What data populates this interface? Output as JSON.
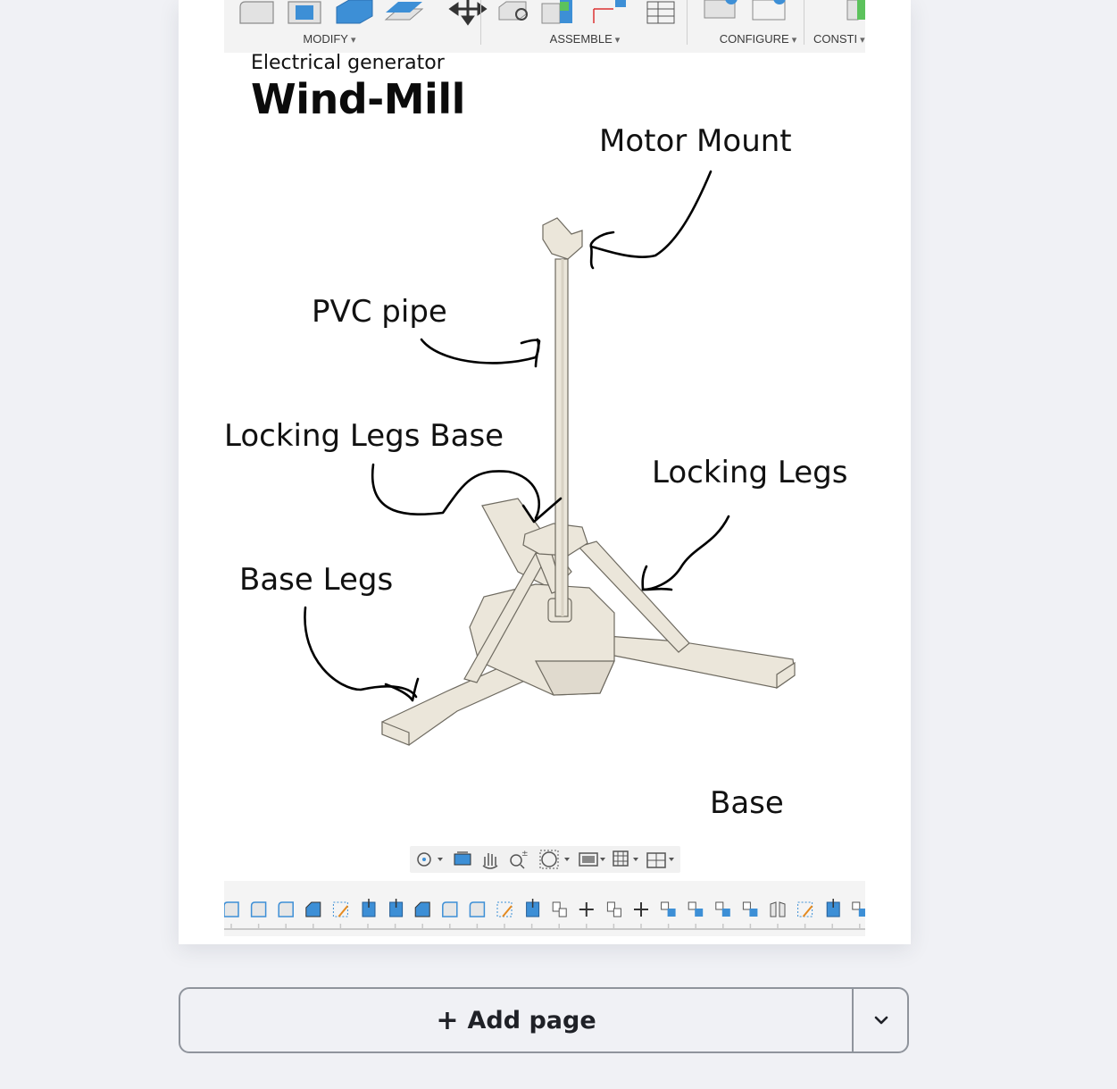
{
  "ribbon": {
    "groups": [
      {
        "label": "MODIFY"
      },
      {
        "label": "ASSEMBLE"
      },
      {
        "label": "CONFIGURE"
      },
      {
        "label": "CONSTI"
      }
    ]
  },
  "slide": {
    "subtitle": "Electrical generator",
    "title": "Wind-Mill",
    "labels": {
      "motor_mount": "Motor Mount",
      "pvc_pipe": "PVC pipe",
      "locking_legs_base": "Locking Legs Base",
      "locking_legs": "Locking Legs",
      "base_legs": "Base Legs",
      "base": "Base"
    }
  },
  "viewport_nav": {
    "icons": [
      "orbit-icon",
      "look-at-icon",
      "pan-hand-icon",
      "zoom-icon",
      "fit-window-icon",
      "display-settings-icon",
      "grid-icon",
      "viewports-icon"
    ]
  },
  "actions": {
    "add_page": "Add page",
    "add_page_icon": "plus-icon",
    "menu_icon": "chevron-down-icon"
  },
  "colors": {
    "page_bg": "#f0f1f5",
    "accent_blue": "#3d8fd6",
    "model": "#ebe6da"
  }
}
